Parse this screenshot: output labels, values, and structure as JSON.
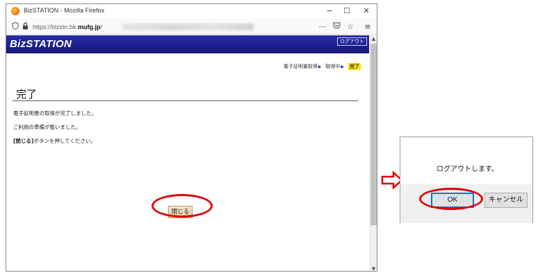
{
  "browser": {
    "title": "BizSTATION - Mozilla Firefox",
    "url_prefix": "https://bizstn.bk.",
    "url_domain": "mufg.jp",
    "url_suffix": "/",
    "controls": {
      "minimize": "−",
      "maximize": "☐",
      "close": "✕"
    },
    "toolbar_icons": [
      "shield-icon",
      "lock-icon",
      "more-icon",
      "pocket-icon",
      "star-icon",
      "menu-icon"
    ]
  },
  "page": {
    "logo": "BizSTATION",
    "logout_label": "ログアウト",
    "steps": [
      {
        "label": "電子証明書取得"
      },
      {
        "label": "取得中"
      },
      {
        "label": "完了"
      }
    ],
    "heading": "完了",
    "messages": {
      "line1": "電子証明書の取得が完了しました。",
      "line2": "ご利用の準備が整いました。",
      "line3_bold": "[閉じる]",
      "line3_rest": "ボタンを押してください。"
    },
    "close_button": "閉じる"
  },
  "dialog": {
    "message": "ログアウトします。",
    "ok_label": "OK",
    "cancel_label": "キャンセル"
  },
  "colors": {
    "header_blue": "#1c1f8c",
    "step_current_bg": "#ffe100",
    "highlight_red": "#e00000",
    "dialog_focus_blue": "#0078d7"
  }
}
